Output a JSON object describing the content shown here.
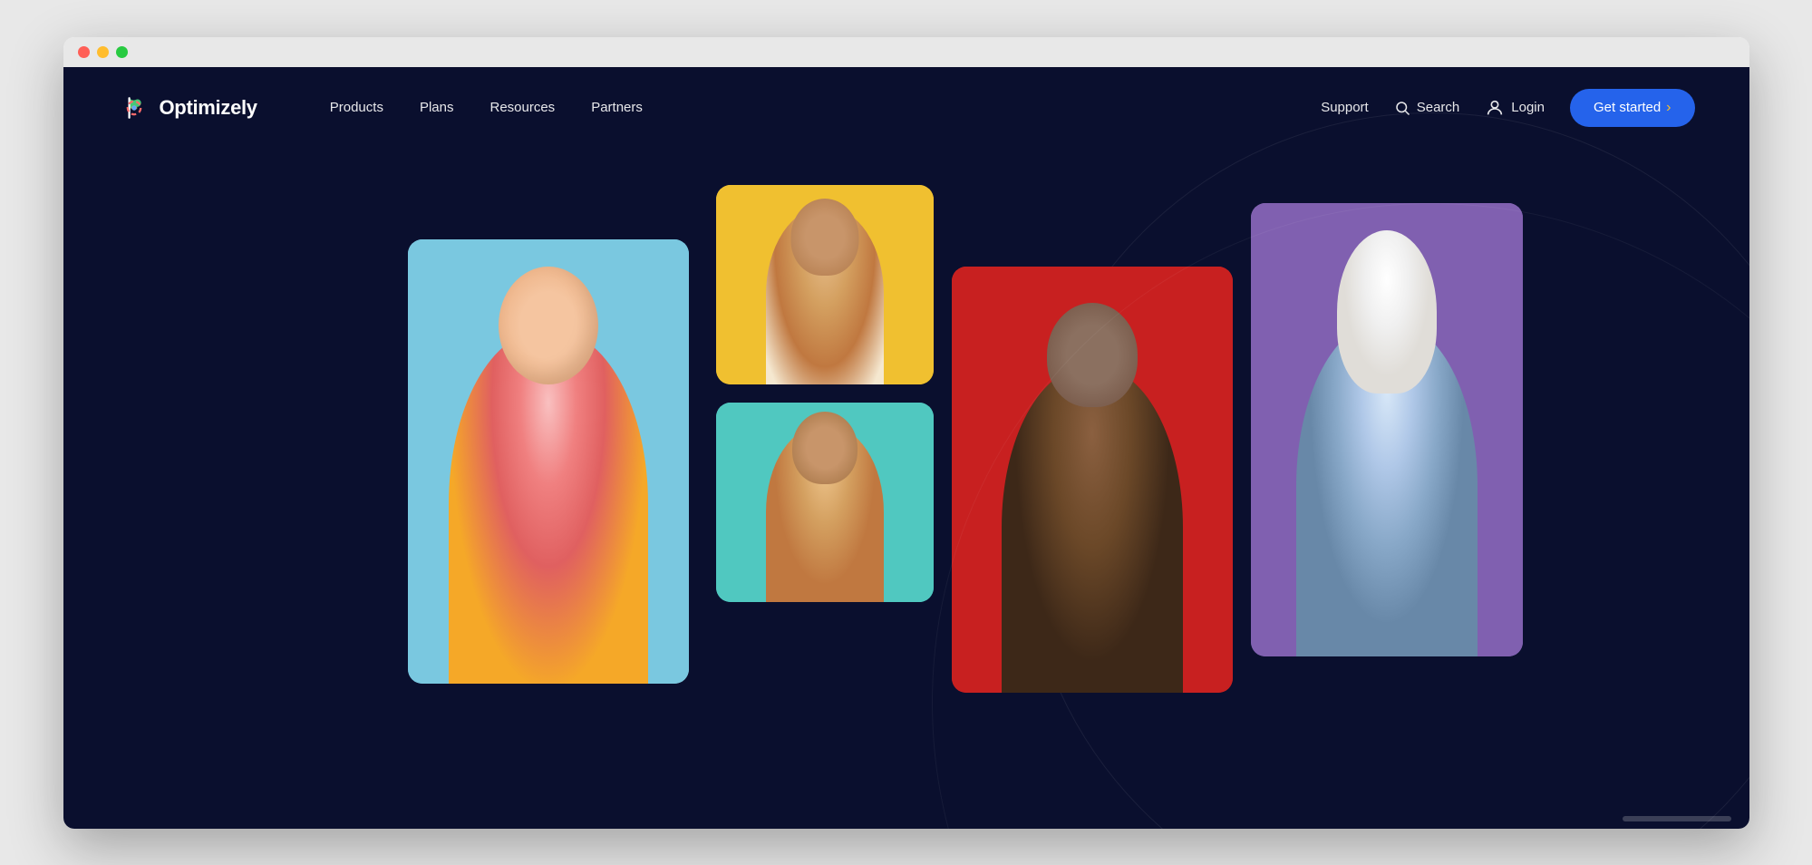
{
  "browser": {
    "traffic_lights": [
      "red",
      "yellow",
      "green"
    ]
  },
  "nav": {
    "logo_text": "Optimizely",
    "links": [
      {
        "label": "Products",
        "id": "products"
      },
      {
        "label": "Plans",
        "id": "plans"
      },
      {
        "label": "Resources",
        "id": "resources"
      },
      {
        "label": "Partners",
        "id": "partners"
      }
    ],
    "right_links": [
      {
        "label": "Support",
        "id": "support"
      }
    ],
    "search_label": "Search",
    "login_label": "Login",
    "cta_label": "Get started"
  },
  "hero": {
    "images": [
      {
        "id": "pink-hair",
        "alt": "Person with pink hair laughing on blue background",
        "position": "left-main"
      },
      {
        "id": "yellow-laugh",
        "alt": "Person laughing on yellow background",
        "position": "top-center"
      },
      {
        "id": "teal-woman",
        "alt": "Woman smiling on teal background",
        "position": "bottom-center"
      },
      {
        "id": "red-man",
        "alt": "Man laughing on red background",
        "position": "center-right"
      },
      {
        "id": "hijab-woman",
        "alt": "Woman in hijab on purple background",
        "position": "right-main"
      }
    ]
  },
  "colors": {
    "bg_dark": "#0a0f2e",
    "nav_link": "#ffffff",
    "cta_bg": "#2563eb",
    "cta_text": "#ffffff",
    "arrow_color": "#fbbf24"
  }
}
